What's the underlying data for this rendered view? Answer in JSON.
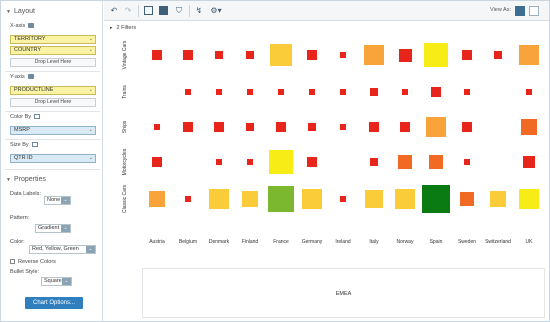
{
  "left_panel": {
    "layout": {
      "title": "Layout"
    },
    "x_axis": {
      "label": "X-axis",
      "fields": [
        "TERRITORY",
        "COUNTRY"
      ],
      "drop": "Drop Level Here"
    },
    "y_axis": {
      "label": "Y-axis",
      "fields": [
        "PRODUCTLINE"
      ],
      "drop": "Drop Level Here"
    },
    "color_by": {
      "label": "Color By",
      "field": "MSRP"
    },
    "size_by": {
      "label": "Size By",
      "field": "QTR ID"
    },
    "properties": {
      "title": "Properties",
      "data_labels": {
        "label": "Data Labels:",
        "value": "None"
      },
      "pattern": {
        "label": "Pattern:",
        "value": "Gradient"
      },
      "color": {
        "label": "Color:",
        "value": "Red, Yellow, Green"
      },
      "reverse_colors": {
        "label": "Reverse Colors",
        "checked": false
      },
      "bullet_style": {
        "label": "Bullet Style:",
        "value": "Square"
      },
      "chart_options": "Chart Options..."
    }
  },
  "toolbar": {
    "view_as": "View As:",
    "icons": [
      "undo-icon",
      "redo-icon",
      "layout-panel-icon",
      "data-table-icon",
      "filter-icon",
      "chart-type-icon",
      "settings-icon"
    ]
  },
  "filters": {
    "label": "2 Filters"
  },
  "chart_data": {
    "type": "heatmap",
    "title": "",
    "x_group": "EMEA",
    "categories": [
      "Austria",
      "Belgium",
      "Denmark",
      "Finland",
      "France",
      "Germany",
      "Ireland",
      "Italy",
      "Norway",
      "Spain",
      "Sweden",
      "Switzerland",
      "UK"
    ],
    "rows": [
      "Vintage Cars",
      "Trains",
      "Ships",
      "Motorcycles",
      "Classic Cars"
    ],
    "colors": {
      "red": "#e8251a",
      "orange_red": "#f06a23",
      "orange": "#f8a43a",
      "yellow_orange": "#fbcc3a",
      "yellow": "#f8ec17",
      "light_green": "#7cb82f",
      "green": "#0a7a12"
    },
    "cells": [
      {
        "row": "Vintage Cars",
        "values": [
          {
            "size": 0.35,
            "color": "red"
          },
          {
            "size": 0.35,
            "color": "red"
          },
          {
            "size": 0.3,
            "color": "red"
          },
          {
            "size": 0.3,
            "color": "red"
          },
          {
            "size": 0.85,
            "color": "yellow_orange"
          },
          {
            "size": 0.35,
            "color": "red"
          },
          {
            "size": 0.2,
            "color": "red"
          },
          {
            "size": 0.75,
            "color": "orange"
          },
          {
            "size": 0.5,
            "color": "red"
          },
          {
            "size": 0.95,
            "color": "yellow"
          },
          {
            "size": 0.35,
            "color": "red"
          },
          {
            "size": 0.3,
            "color": "red"
          },
          {
            "size": 0.75,
            "color": "orange"
          }
        ]
      },
      {
        "row": "Trains",
        "values": [
          null,
          {
            "size": 0.25,
            "color": "red"
          },
          {
            "size": 0.25,
            "color": "red"
          },
          {
            "size": 0.25,
            "color": "red"
          },
          {
            "size": 0.25,
            "color": "red"
          },
          {
            "size": 0.2,
            "color": "red"
          },
          {
            "size": 0.2,
            "color": "red"
          },
          {
            "size": 0.3,
            "color": "red"
          },
          {
            "size": 0.25,
            "color": "red"
          },
          {
            "size": 0.4,
            "color": "red"
          },
          {
            "size": 0.25,
            "color": "red"
          },
          null,
          {
            "size": 0.25,
            "color": "red"
          }
        ]
      },
      {
        "row": "Ships",
        "values": [
          {
            "size": 0.25,
            "color": "red"
          },
          {
            "size": 0.4,
            "color": "red"
          },
          {
            "size": 0.4,
            "color": "red"
          },
          {
            "size": 0.3,
            "color": "red"
          },
          {
            "size": 0.4,
            "color": "red"
          },
          {
            "size": 0.3,
            "color": "red"
          },
          {
            "size": 0.2,
            "color": "red"
          },
          {
            "size": 0.35,
            "color": "red"
          },
          {
            "size": 0.35,
            "color": "red"
          },
          {
            "size": 0.8,
            "color": "orange"
          },
          {
            "size": 0.4,
            "color": "red"
          },
          null,
          {
            "size": 0.6,
            "color": "orange_red"
          }
        ]
      },
      {
        "row": "Motorcycles",
        "values": [
          {
            "size": 0.35,
            "color": "red"
          },
          null,
          {
            "size": 0.25,
            "color": "red"
          },
          {
            "size": 0.25,
            "color": "red"
          },
          {
            "size": 0.9,
            "color": "yellow"
          },
          {
            "size": 0.35,
            "color": "red"
          },
          null,
          {
            "size": 0.3,
            "color": "red"
          },
          {
            "size": 0.55,
            "color": "orange_red"
          },
          {
            "size": 0.55,
            "color": "orange_red"
          },
          {
            "size": 0.2,
            "color": "red"
          },
          null,
          {
            "size": 0.45,
            "color": "red"
          }
        ]
      },
      {
        "row": "Classic Cars",
        "values": [
          {
            "size": 0.6,
            "color": "orange"
          },
          {
            "size": 0.25,
            "color": "red"
          },
          {
            "size": 0.75,
            "color": "yellow_orange"
          },
          {
            "size": 0.6,
            "color": "yellow_orange"
          },
          {
            "size": 1.0,
            "color": "light_green"
          },
          {
            "size": 0.8,
            "color": "yellow_orange"
          },
          {
            "size": 0.2,
            "color": "red"
          },
          {
            "size": 0.7,
            "color": "yellow_orange"
          },
          {
            "size": 0.8,
            "color": "yellow_orange"
          },
          {
            "size": 1.1,
            "color": "green"
          },
          {
            "size": 0.55,
            "color": "orange_red"
          },
          {
            "size": 0.6,
            "color": "yellow_orange"
          },
          {
            "size": 0.8,
            "color": "yellow"
          }
        ]
      }
    ]
  }
}
